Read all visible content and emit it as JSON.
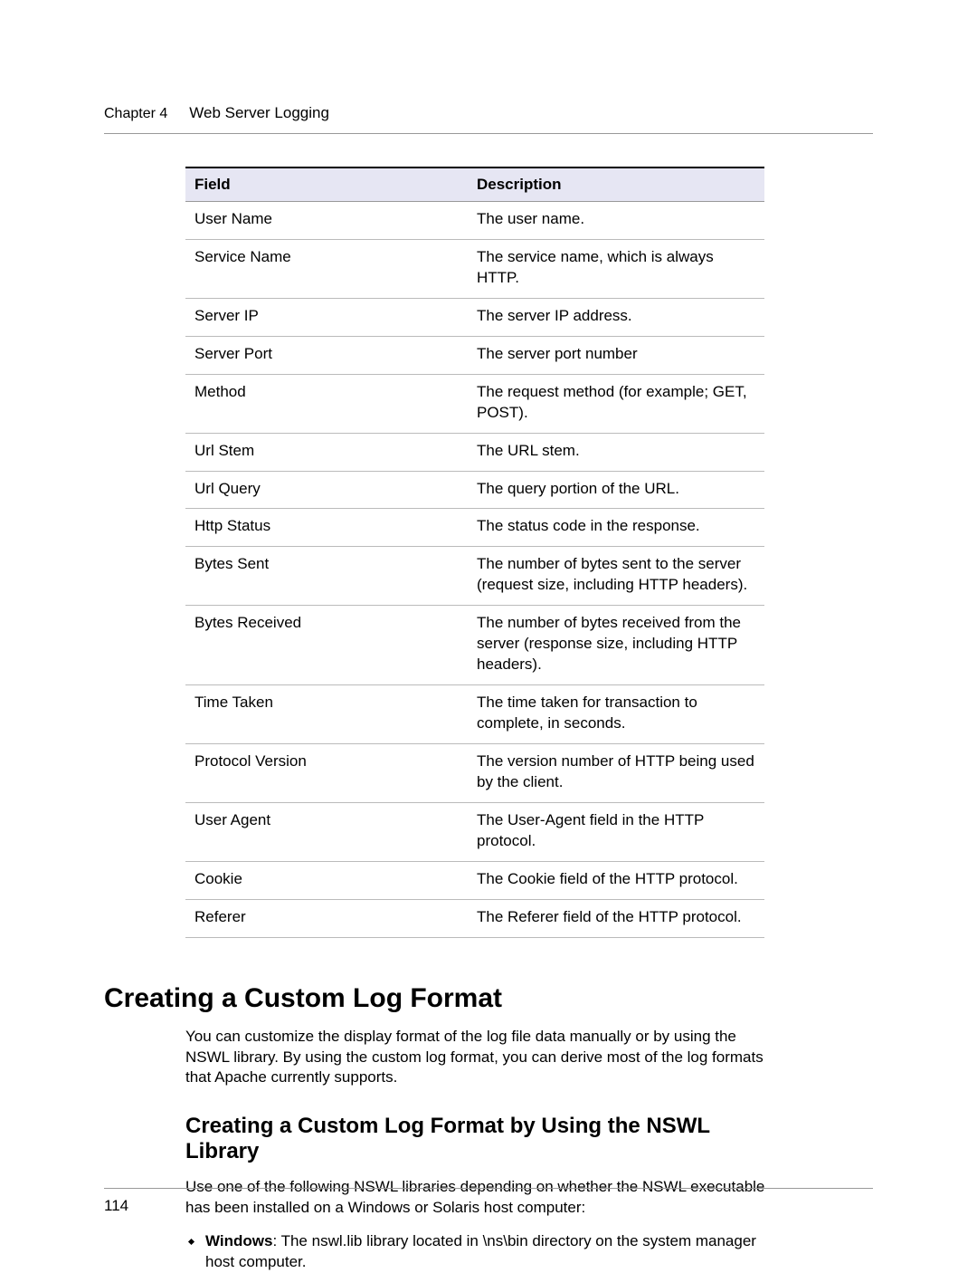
{
  "header": {
    "chapter": "Chapter 4",
    "title": "Web Server Logging"
  },
  "table": {
    "columns": {
      "field": "Field",
      "description": "Description"
    },
    "rows": [
      {
        "field": "User Name",
        "description": "The user name."
      },
      {
        "field": "Service Name",
        "description": "The service name, which is always HTTP."
      },
      {
        "field": "Server IP",
        "description": "The server IP address."
      },
      {
        "field": "Server Port",
        "description": "The server port number"
      },
      {
        "field": "Method",
        "description": "The request method (for example; GET, POST)."
      },
      {
        "field": "Url Stem",
        "description": "The URL stem."
      },
      {
        "field": "Url Query",
        "description": "The query portion of the URL."
      },
      {
        "field": "Http Status",
        "description": "The status code in the response."
      },
      {
        "field": "Bytes Sent",
        "description": "The number of bytes sent to the server (request size, including HTTP headers)."
      },
      {
        "field": "Bytes Received",
        "description": "The number of bytes received from the server (response size, including HTTP headers)."
      },
      {
        "field": "Time Taken",
        "description": "The time taken for transaction to complete, in seconds."
      },
      {
        "field": "Protocol Version",
        "description": "The version number of HTTP being used by the client."
      },
      {
        "field": "User Agent",
        "description": "The User-Agent field in the HTTP protocol."
      },
      {
        "field": "Cookie",
        "description": "The Cookie field of the HTTP protocol."
      },
      {
        "field": "Referer",
        "description": "The Referer field of the HTTP protocol."
      }
    ]
  },
  "section": {
    "heading": "Creating a Custom Log Format",
    "intro": "You can customize the display format of the log file data manually or by using the NSWL library. By using the custom log format, you can derive most of the log formats that Apache currently supports.",
    "subheading": "Creating a Custom Log Format by Using the NSWL Library",
    "subintro": "Use one of the following NSWL libraries depending on whether the NSWL executable has been installed on a Windows or Solaris host computer:",
    "bullets": [
      {
        "lead": "Windows",
        "rest": ": The nswl.lib library located in \\ns\\bin directory on the system manager host computer."
      }
    ]
  },
  "page_number": "114"
}
